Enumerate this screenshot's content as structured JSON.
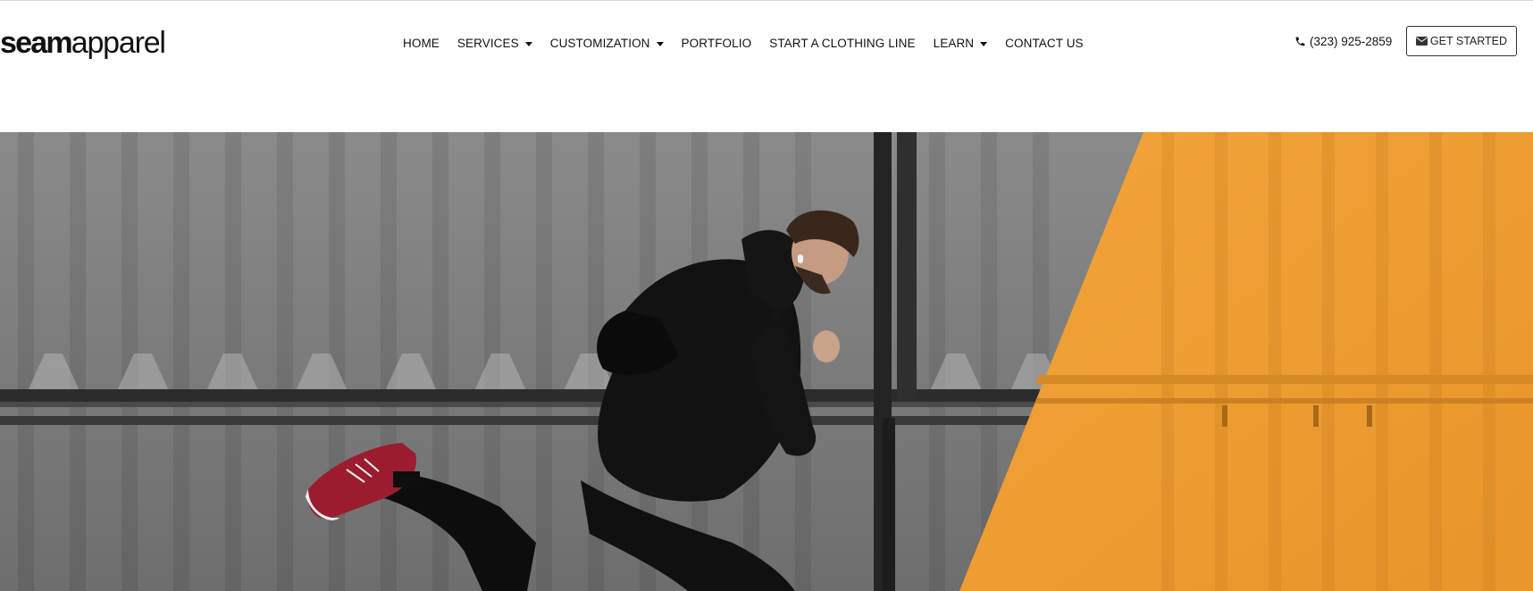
{
  "brand": {
    "logo_bold": "seam",
    "logo_light": "apparel"
  },
  "nav": [
    {
      "label": "HOME",
      "dropdown": false
    },
    {
      "label": "SERVICES",
      "dropdown": true
    },
    {
      "label": "CUSTOMIZATION",
      "dropdown": true
    },
    {
      "label": "PORTFOLIO",
      "dropdown": false
    },
    {
      "label": "START A CLOTHING LINE",
      "dropdown": false
    },
    {
      "label": "LEARN",
      "dropdown": true
    },
    {
      "label": "CONTACT US",
      "dropdown": false
    }
  ],
  "contact": {
    "phone": "(323) 925-2859",
    "phone_icon": "phone-icon"
  },
  "cta": {
    "label": "GET STARTED",
    "icon": "envelope-icon"
  },
  "hero": {
    "image": "man-running-in-black-hoodie-against-gray-and-orange-container"
  },
  "colors": {
    "orange": "#f0a033",
    "gray_wall": "#7d7d7d",
    "shoe_red": "#9b1c2e"
  }
}
